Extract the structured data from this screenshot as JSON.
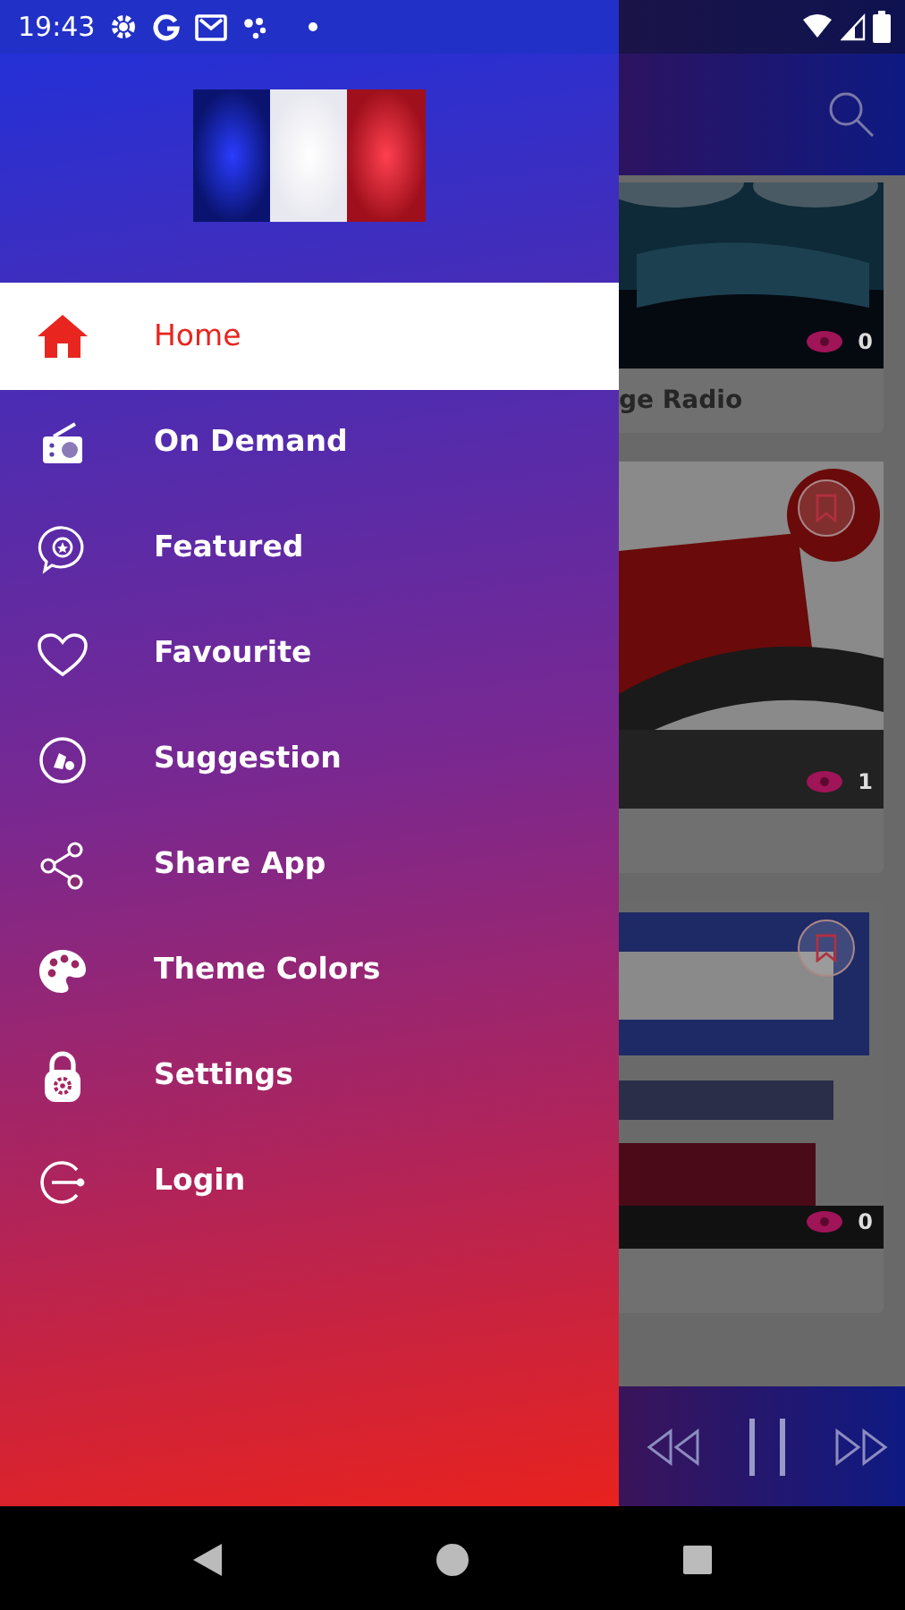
{
  "status_bar": {
    "time": "19:43"
  },
  "drawer": {
    "items": [
      {
        "label": "Home",
        "selected": true
      },
      {
        "label": "On Demand",
        "selected": false
      },
      {
        "label": "Featured",
        "selected": false
      },
      {
        "label": "Favourite",
        "selected": false
      },
      {
        "label": "Suggestion",
        "selected": false
      },
      {
        "label": "Share App",
        "selected": false
      },
      {
        "label": "Theme Colors",
        "selected": false
      },
      {
        "label": "Settings",
        "selected": false
      },
      {
        "label": "Login",
        "selected": false
      }
    ]
  },
  "background_screen": {
    "stations": [
      {
        "title": "ge Radio",
        "views": "0",
        "bookmark": false
      },
      {
        "views": "1",
        "bookmark": true
      },
      {
        "views": "0",
        "bookmark": true
      }
    ]
  }
}
